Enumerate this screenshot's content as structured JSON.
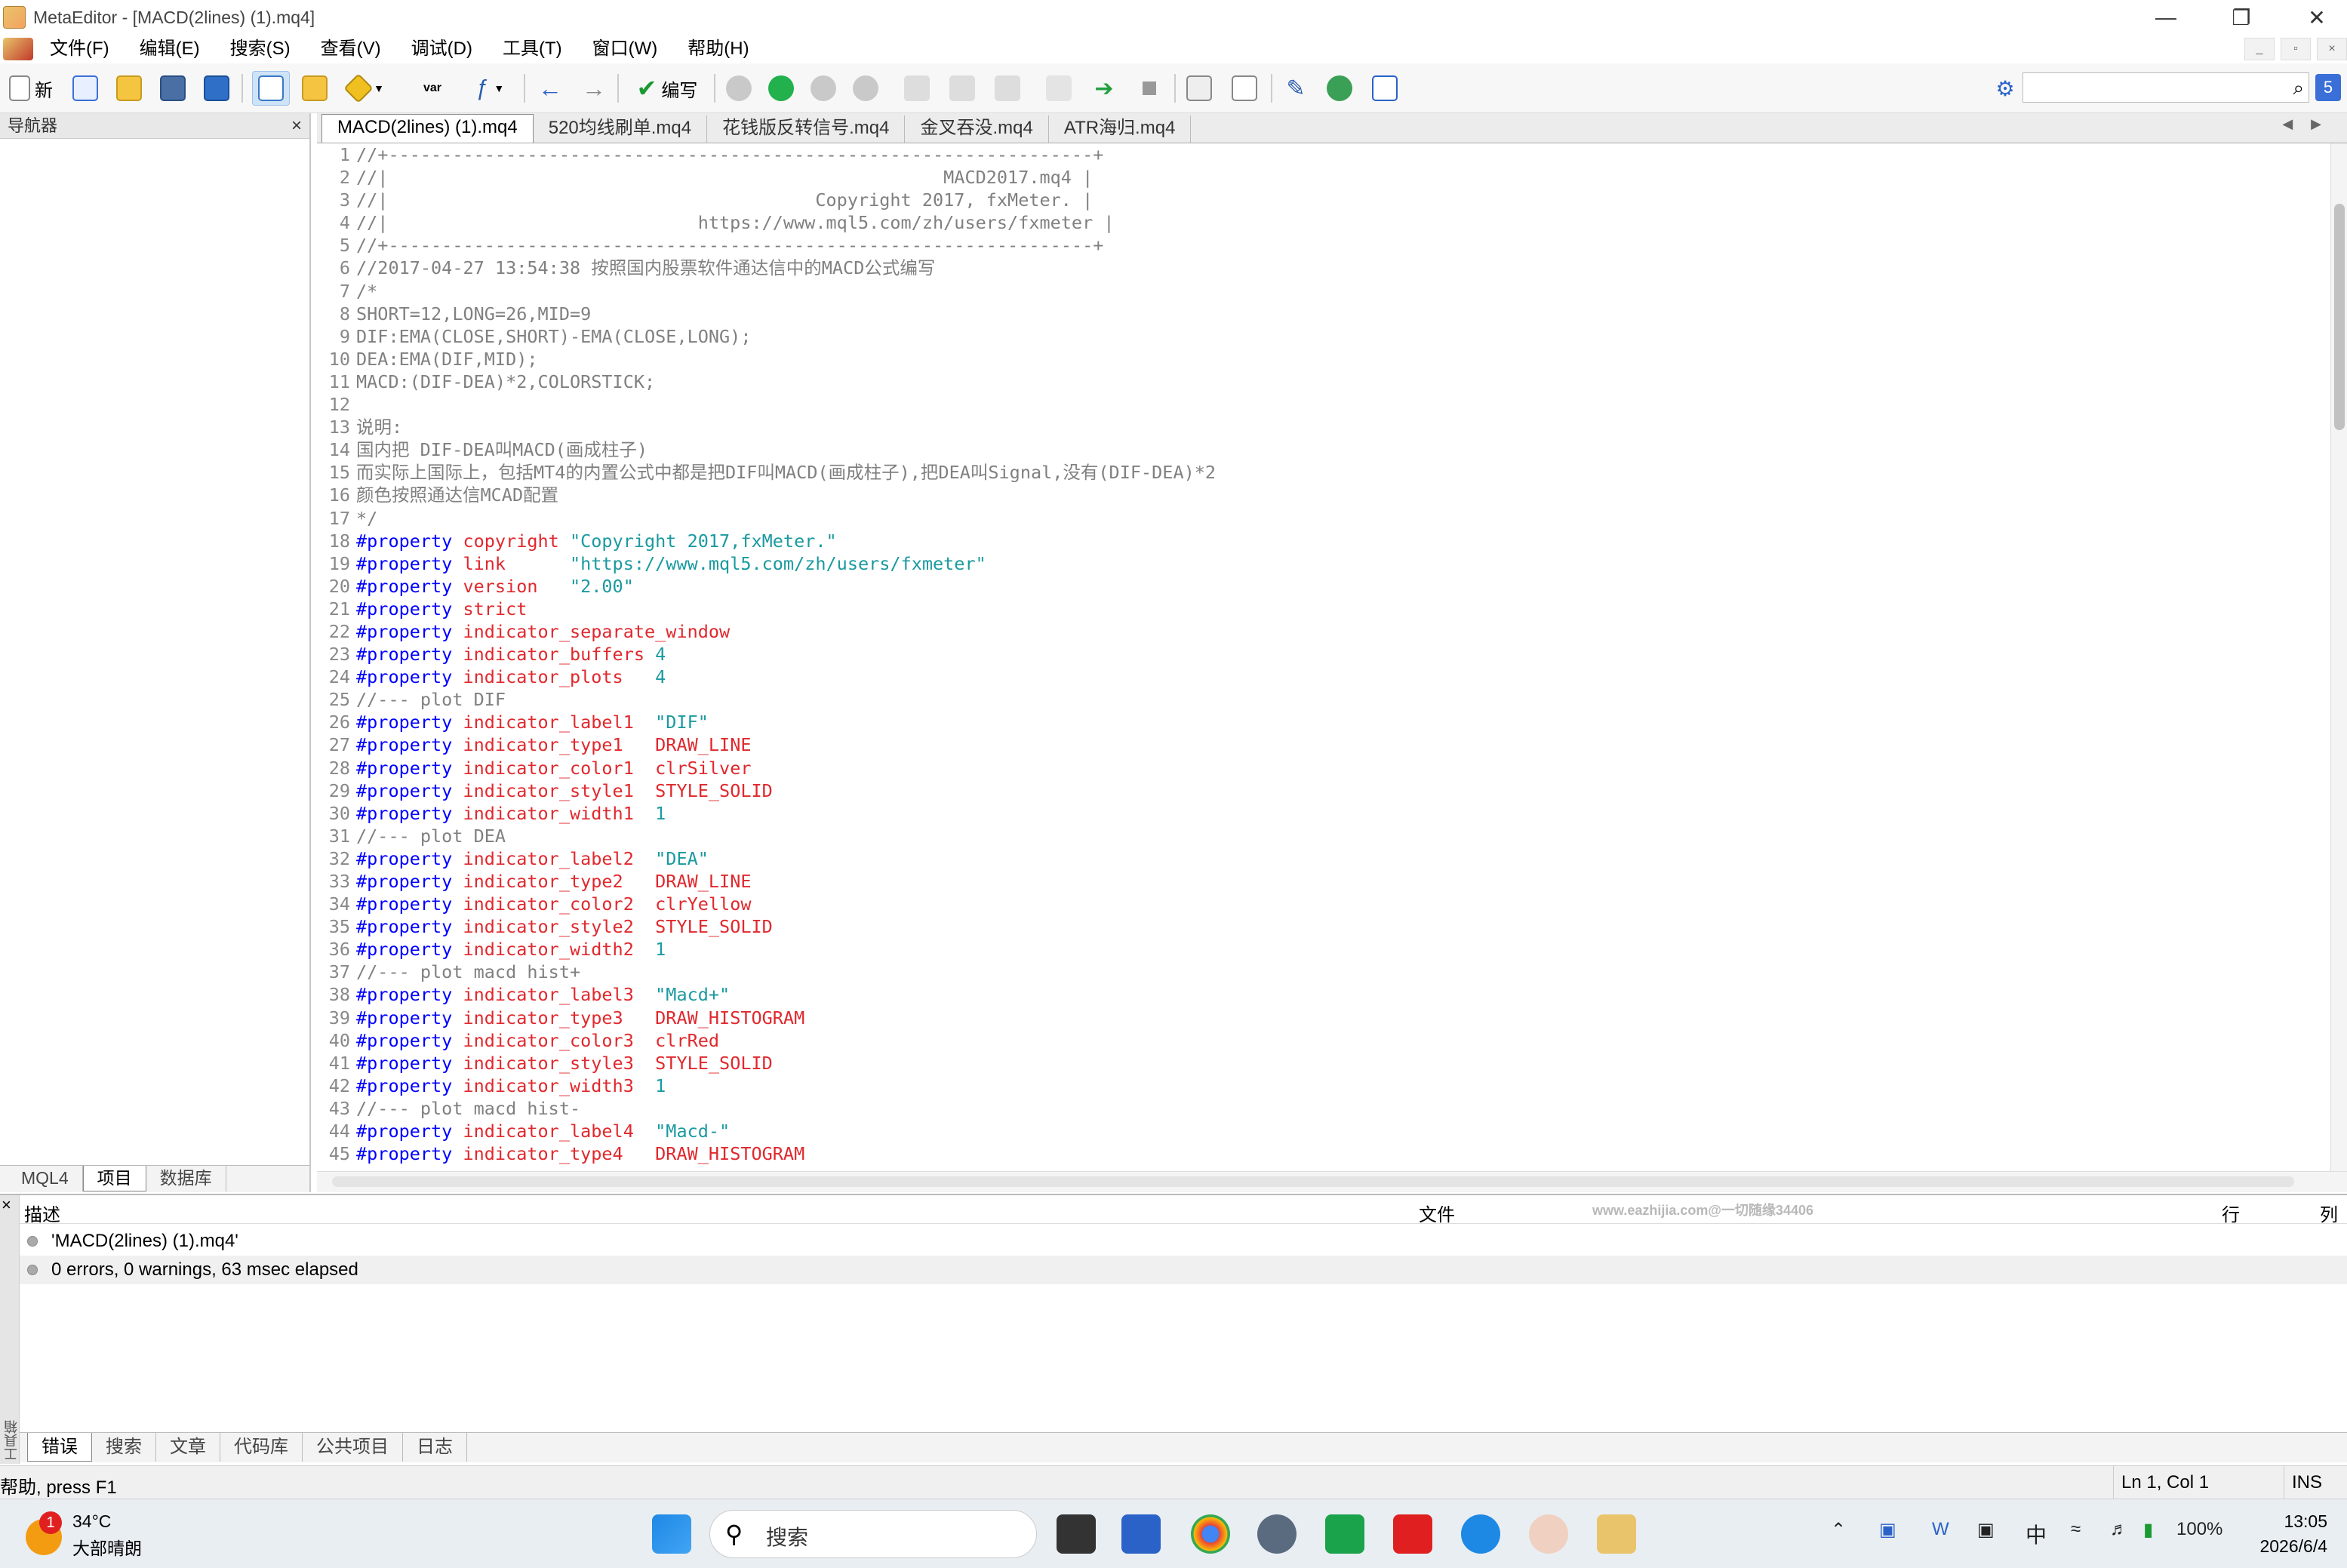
{
  "window": {
    "title": "MetaEditor - [MACD(2lines) (1).mq4]"
  },
  "menu": [
    "文件(F)",
    "编辑(E)",
    "搜索(S)",
    "查看(V)",
    "调试(D)",
    "工具(T)",
    "窗口(W)",
    "帮助(H)"
  ],
  "toolbar": {
    "new_label": "新",
    "compile_label": "编写",
    "var_label": "var"
  },
  "navigator": {
    "title": "导航器",
    "tabs": [
      "MQL4",
      "项目",
      "数据库"
    ]
  },
  "file_tabs": [
    "MACD(2lines) (1).mq4",
    "520均线刷单.mq4",
    "花钱版反转信号.mq4",
    "金叉吞没.mq4",
    "ATR海归.mq4"
  ],
  "code_lines": [
    [
      [
        "lt",
        "//+------------------------------------------------------------------+"
      ]
    ],
    [
      [
        "lt",
        "//|                                                    MACD2017.mq4 |"
      ]
    ],
    [
      [
        "lt",
        "//|                                        Copyright 2017, fxMeter. |"
      ]
    ],
    [
      [
        "lt",
        "//|                             https://www.mql5.com/zh/users/fxmeter |"
      ]
    ],
    [
      [
        "lt",
        "//+------------------------------------------------------------------+"
      ]
    ],
    [
      [
        "cm",
        "//2017-04-27 13:54:38 按照国内股票软件通达信中的MACD公式编写"
      ]
    ],
    [
      [
        "cm",
        "/*"
      ]
    ],
    [
      [
        "cm",
        "SHORT=12,LONG=26,MID=9"
      ]
    ],
    [
      [
        "cm",
        "DIF:EMA(CLOSE,SHORT)-EMA(CLOSE,LONG);"
      ]
    ],
    [
      [
        "cm",
        "DEA:EMA(DIF,MID);"
      ]
    ],
    [
      [
        "cm",
        "MACD:(DIF-DEA)*2,COLORSTICK;"
      ]
    ],
    [
      [
        "cm",
        ""
      ]
    ],
    [
      [
        "cm",
        "说明:"
      ]
    ],
    [
      [
        "cm",
        "国内把 DIF-DEA叫MACD(画成柱子)"
      ]
    ],
    [
      [
        "cm",
        "而实际上国际上，包括MT4的内置公式中都是把DIF叫MACD(画成柱子),把DEA叫Signal,没有(DIF-DEA)*2"
      ]
    ],
    [
      [
        "cm",
        "颜色按照通达信MCAD配置"
      ]
    ],
    [
      [
        "cm",
        "*/"
      ]
    ],
    [
      [
        "kw",
        "#property "
      ],
      [
        "pr",
        "copyright "
      ],
      [
        "st",
        "\"Copyright 2017,fxMeter.\""
      ]
    ],
    [
      [
        "kw",
        "#property "
      ],
      [
        "pr",
        "link      "
      ],
      [
        "st",
        "\"https://www.mql5.com/zh/users/fxmeter\""
      ]
    ],
    [
      [
        "kw",
        "#property "
      ],
      [
        "pr",
        "version   "
      ],
      [
        "st",
        "\"2.00\""
      ]
    ],
    [
      [
        "kw",
        "#property "
      ],
      [
        "pr",
        "strict"
      ]
    ],
    [
      [
        "kw",
        "#property "
      ],
      [
        "pr",
        "indicator_separate_window"
      ]
    ],
    [
      [
        "kw",
        "#property "
      ],
      [
        "pr",
        "indicator_buffers "
      ],
      [
        "st",
        "4"
      ]
    ],
    [
      [
        "kw",
        "#property "
      ],
      [
        "pr",
        "indicator_plots   "
      ],
      [
        "st",
        "4"
      ]
    ],
    [
      [
        "cm",
        "//--- plot DIF"
      ]
    ],
    [
      [
        "kw",
        "#property "
      ],
      [
        "pr",
        "indicator_label1  "
      ],
      [
        "st",
        "\"DIF\""
      ]
    ],
    [
      [
        "kw",
        "#property "
      ],
      [
        "pr",
        "indicator_type1   DRAW_LINE"
      ]
    ],
    [
      [
        "kw",
        "#property "
      ],
      [
        "pr",
        "indicator_color1  clrSilver"
      ]
    ],
    [
      [
        "kw",
        "#property "
      ],
      [
        "pr",
        "indicator_style1  STYLE_SOLID"
      ]
    ],
    [
      [
        "kw",
        "#property "
      ],
      [
        "pr",
        "indicator_width1  "
      ],
      [
        "st",
        "1"
      ]
    ],
    [
      [
        "cm",
        "//--- plot DEA"
      ]
    ],
    [
      [
        "kw",
        "#property "
      ],
      [
        "pr",
        "indicator_label2  "
      ],
      [
        "st",
        "\"DEA\""
      ]
    ],
    [
      [
        "kw",
        "#property "
      ],
      [
        "pr",
        "indicator_type2   DRAW_LINE"
      ]
    ],
    [
      [
        "kw",
        "#property "
      ],
      [
        "pr",
        "indicator_color2  clrYellow"
      ]
    ],
    [
      [
        "kw",
        "#property "
      ],
      [
        "pr",
        "indicator_style2  STYLE_SOLID"
      ]
    ],
    [
      [
        "kw",
        "#property "
      ],
      [
        "pr",
        "indicator_width2  "
      ],
      [
        "st",
        "1"
      ]
    ],
    [
      [
        "cm",
        "//--- plot macd hist+"
      ]
    ],
    [
      [
        "kw",
        "#property "
      ],
      [
        "pr",
        "indicator_label3  "
      ],
      [
        "st",
        "\"Macd+\""
      ]
    ],
    [
      [
        "kw",
        "#property "
      ],
      [
        "pr",
        "indicator_type3   DRAW_HISTOGRAM"
      ]
    ],
    [
      [
        "kw",
        "#property "
      ],
      [
        "pr",
        "indicator_color3  clrRed"
      ]
    ],
    [
      [
        "kw",
        "#property "
      ],
      [
        "pr",
        "indicator_style3  STYLE_SOLID"
      ]
    ],
    [
      [
        "kw",
        "#property "
      ],
      [
        "pr",
        "indicator_width3  "
      ],
      [
        "st",
        "1"
      ]
    ],
    [
      [
        "cm",
        "//--- plot macd hist-"
      ]
    ],
    [
      [
        "kw",
        "#property "
      ],
      [
        "pr",
        "indicator_label4  "
      ],
      [
        "st",
        "\"Macd-\""
      ]
    ],
    [
      [
        "kw",
        "#property "
      ],
      [
        "pr",
        "indicator_type4   DRAW_HISTOGRAM"
      ]
    ]
  ],
  "toolbox": {
    "columns": {
      "desc": "描述",
      "file": "文件",
      "line": "行",
      "col": "列"
    },
    "watermark": "www.eazhijia.com@一切随缘34406",
    "rows": [
      "'MACD(2lines) (1).mq4'",
      "0 errors, 0 warnings, 63 msec elapsed"
    ],
    "tabs": [
      "错误",
      "搜索",
      "文章",
      "代码库",
      "公共项目",
      "日志"
    ],
    "side_label": "工具箱"
  },
  "status": {
    "help": "帮助, press F1",
    "position": "Ln 1, Col 1",
    "mode": "INS"
  },
  "taskbar": {
    "weather_badge": "1",
    "temp": "34°C",
    "weather": "大部晴朗",
    "search": "搜索",
    "ime": "中",
    "battery": "100%",
    "time": "13:05",
    "date": "2026/6/4"
  },
  "colors": {
    "keyword": "#0000ff",
    "property": "#e0282d",
    "string": "#1a9aa0",
    "comment": "#808080"
  }
}
